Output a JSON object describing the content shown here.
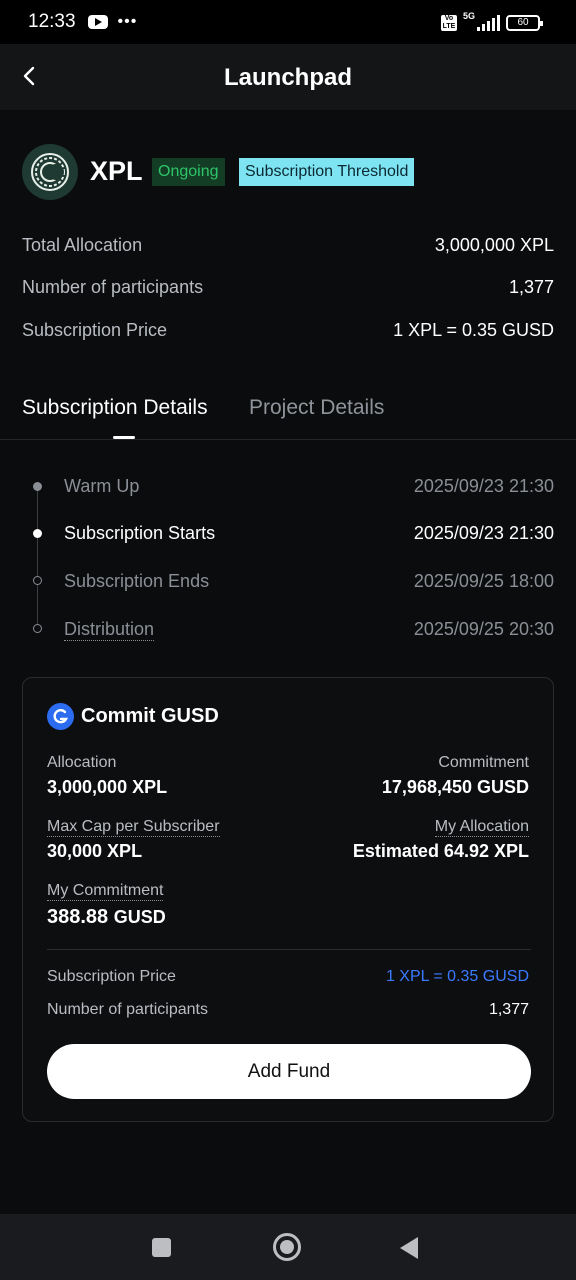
{
  "status_bar": {
    "time": "12:33",
    "network": "5G",
    "battery": "60",
    "icons": [
      "youtube-icon",
      "more-dots-icon",
      "volte-icon",
      "signal-icon",
      "battery-icon"
    ]
  },
  "header": {
    "title": "Launchpad",
    "back_icon": "chevron-left-icon"
  },
  "project": {
    "name": "XPL",
    "status_badge": "Ongoing",
    "type_badge": "Subscription Threshold",
    "info": [
      {
        "label": "Total Allocation",
        "value": "3,000,000 XPL"
      },
      {
        "label": "Number of participants",
        "value": "1,377"
      },
      {
        "label": "Subscription Price",
        "value": "1 XPL = 0.35 GUSD"
      }
    ]
  },
  "tabs": [
    {
      "label": "Subscription Details",
      "active": true
    },
    {
      "label": "Project Details",
      "active": false
    }
  ],
  "timeline": [
    {
      "label": "Warm Up",
      "date": "2025/09/23 21:30",
      "state": "past"
    },
    {
      "label": "Subscription Starts",
      "date": "2025/09/23 21:30",
      "state": "current"
    },
    {
      "label": "Subscription Ends",
      "date": "2025/09/25 18:00",
      "state": "upcoming"
    },
    {
      "label": "Distribution",
      "date": "2025/09/25 20:30",
      "state": "upcoming"
    }
  ],
  "commit": {
    "title": "Commit GUSD",
    "allocation_label": "Allocation",
    "allocation_value": "3,000,000 XPL",
    "commitment_label": "Commitment",
    "commitment_value": "17,968,450 GUSD",
    "max_cap_label": "Max Cap per Subscriber",
    "max_cap_value": "30,000 XPL",
    "my_allocation_label": "My Allocation",
    "my_allocation_value": "Estimated 64.92 XPL",
    "my_commitment_label": "My Commitment",
    "my_commitment_value": "388.88",
    "my_commitment_unit": "GUSD",
    "price_label": "Subscription Price",
    "price_value": "1 XPL = 0.35 GUSD",
    "participants_label": "Number of participants",
    "participants_value": "1,377",
    "button": "Add Fund"
  },
  "colors": {
    "accent_green": "#2ec56a",
    "threshold_badge": "#7fe4f2",
    "link_blue": "#3b7bff",
    "background": "#0b0c0e"
  }
}
